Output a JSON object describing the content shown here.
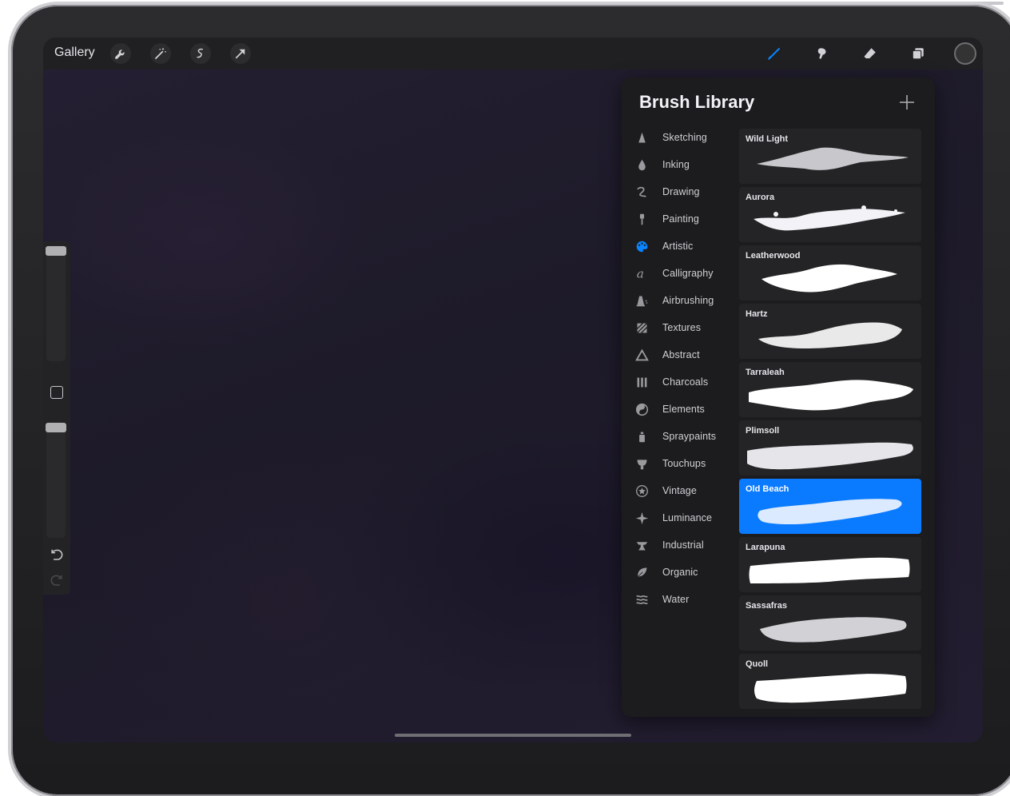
{
  "topbar": {
    "gallery_label": "Gallery",
    "left_tools": [
      "wrench-icon",
      "magic-wand-icon",
      "selection-icon",
      "transform-arrow-icon"
    ],
    "right_tools": [
      "brush-icon",
      "smudge-icon",
      "eraser-icon",
      "layers-icon"
    ],
    "active_tool": "brush-icon",
    "accent_color": "#0a84ff",
    "current_color": "#333333"
  },
  "brush_library": {
    "title": "Brush Library",
    "categories": [
      {
        "label": "Sketching",
        "icon": "pencil-tip-icon"
      },
      {
        "label": "Inking",
        "icon": "ink-drop-icon"
      },
      {
        "label": "Drawing",
        "icon": "squiggle-icon"
      },
      {
        "label": "Painting",
        "icon": "paintbrush-icon"
      },
      {
        "label": "Artistic",
        "icon": "palette-icon"
      },
      {
        "label": "Calligraphy",
        "icon": "calligraphy-a-icon"
      },
      {
        "label": "Airbrushing",
        "icon": "airbrush-icon"
      },
      {
        "label": "Textures",
        "icon": "texture-icon"
      },
      {
        "label": "Abstract",
        "icon": "triangle-icon"
      },
      {
        "label": "Charcoals",
        "icon": "charcoal-bars-icon"
      },
      {
        "label": "Elements",
        "icon": "yin-yang-icon"
      },
      {
        "label": "Spraypaints",
        "icon": "spray-can-icon"
      },
      {
        "label": "Touchups",
        "icon": "touchup-icon"
      },
      {
        "label": "Vintage",
        "icon": "star-badge-icon"
      },
      {
        "label": "Luminance",
        "icon": "sparkle-icon"
      },
      {
        "label": "Industrial",
        "icon": "anvil-icon"
      },
      {
        "label": "Organic",
        "icon": "leaf-icon"
      },
      {
        "label": "Water",
        "icon": "waves-icon"
      }
    ],
    "active_category": "Artistic",
    "brushes": [
      {
        "name": "Wild Light"
      },
      {
        "name": "Aurora"
      },
      {
        "name": "Leatherwood"
      },
      {
        "name": "Hartz"
      },
      {
        "name": "Tarraleah"
      },
      {
        "name": "Plimsoll"
      },
      {
        "name": "Old Beach"
      },
      {
        "name": "Larapuna"
      },
      {
        "name": "Sassafras"
      },
      {
        "name": "Quoll"
      }
    ],
    "selected_brush": "Old Beach"
  }
}
